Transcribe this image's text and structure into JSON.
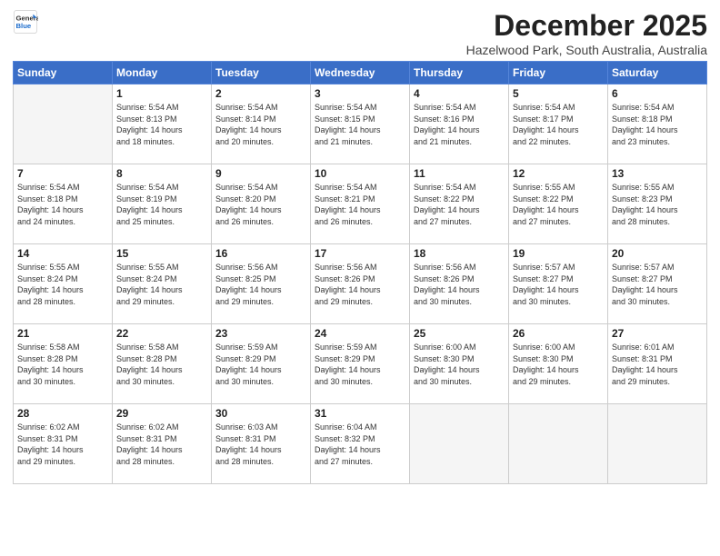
{
  "logo": {
    "general": "General",
    "blue": "Blue"
  },
  "header": {
    "title": "December 2025",
    "location": "Hazelwood Park, South Australia, Australia"
  },
  "weekdays": [
    "Sunday",
    "Monday",
    "Tuesday",
    "Wednesday",
    "Thursday",
    "Friday",
    "Saturday"
  ],
  "weeks": [
    [
      {
        "day": "",
        "text": ""
      },
      {
        "day": "1",
        "text": "Sunrise: 5:54 AM\nSunset: 8:13 PM\nDaylight: 14 hours\nand 18 minutes."
      },
      {
        "day": "2",
        "text": "Sunrise: 5:54 AM\nSunset: 8:14 PM\nDaylight: 14 hours\nand 20 minutes."
      },
      {
        "day": "3",
        "text": "Sunrise: 5:54 AM\nSunset: 8:15 PM\nDaylight: 14 hours\nand 21 minutes."
      },
      {
        "day": "4",
        "text": "Sunrise: 5:54 AM\nSunset: 8:16 PM\nDaylight: 14 hours\nand 21 minutes."
      },
      {
        "day": "5",
        "text": "Sunrise: 5:54 AM\nSunset: 8:17 PM\nDaylight: 14 hours\nand 22 minutes."
      },
      {
        "day": "6",
        "text": "Sunrise: 5:54 AM\nSunset: 8:18 PM\nDaylight: 14 hours\nand 23 minutes."
      }
    ],
    [
      {
        "day": "7",
        "text": "Sunrise: 5:54 AM\nSunset: 8:18 PM\nDaylight: 14 hours\nand 24 minutes."
      },
      {
        "day": "8",
        "text": "Sunrise: 5:54 AM\nSunset: 8:19 PM\nDaylight: 14 hours\nand 25 minutes."
      },
      {
        "day": "9",
        "text": "Sunrise: 5:54 AM\nSunset: 8:20 PM\nDaylight: 14 hours\nand 26 minutes."
      },
      {
        "day": "10",
        "text": "Sunrise: 5:54 AM\nSunset: 8:21 PM\nDaylight: 14 hours\nand 26 minutes."
      },
      {
        "day": "11",
        "text": "Sunrise: 5:54 AM\nSunset: 8:22 PM\nDaylight: 14 hours\nand 27 minutes."
      },
      {
        "day": "12",
        "text": "Sunrise: 5:55 AM\nSunset: 8:22 PM\nDaylight: 14 hours\nand 27 minutes."
      },
      {
        "day": "13",
        "text": "Sunrise: 5:55 AM\nSunset: 8:23 PM\nDaylight: 14 hours\nand 28 minutes."
      }
    ],
    [
      {
        "day": "14",
        "text": "Sunrise: 5:55 AM\nSunset: 8:24 PM\nDaylight: 14 hours\nand 28 minutes."
      },
      {
        "day": "15",
        "text": "Sunrise: 5:55 AM\nSunset: 8:24 PM\nDaylight: 14 hours\nand 29 minutes."
      },
      {
        "day": "16",
        "text": "Sunrise: 5:56 AM\nSunset: 8:25 PM\nDaylight: 14 hours\nand 29 minutes."
      },
      {
        "day": "17",
        "text": "Sunrise: 5:56 AM\nSunset: 8:26 PM\nDaylight: 14 hours\nand 29 minutes."
      },
      {
        "day": "18",
        "text": "Sunrise: 5:56 AM\nSunset: 8:26 PM\nDaylight: 14 hours\nand 30 minutes."
      },
      {
        "day": "19",
        "text": "Sunrise: 5:57 AM\nSunset: 8:27 PM\nDaylight: 14 hours\nand 30 minutes."
      },
      {
        "day": "20",
        "text": "Sunrise: 5:57 AM\nSunset: 8:27 PM\nDaylight: 14 hours\nand 30 minutes."
      }
    ],
    [
      {
        "day": "21",
        "text": "Sunrise: 5:58 AM\nSunset: 8:28 PM\nDaylight: 14 hours\nand 30 minutes."
      },
      {
        "day": "22",
        "text": "Sunrise: 5:58 AM\nSunset: 8:28 PM\nDaylight: 14 hours\nand 30 minutes."
      },
      {
        "day": "23",
        "text": "Sunrise: 5:59 AM\nSunset: 8:29 PM\nDaylight: 14 hours\nand 30 minutes."
      },
      {
        "day": "24",
        "text": "Sunrise: 5:59 AM\nSunset: 8:29 PM\nDaylight: 14 hours\nand 30 minutes."
      },
      {
        "day": "25",
        "text": "Sunrise: 6:00 AM\nSunset: 8:30 PM\nDaylight: 14 hours\nand 30 minutes."
      },
      {
        "day": "26",
        "text": "Sunrise: 6:00 AM\nSunset: 8:30 PM\nDaylight: 14 hours\nand 29 minutes."
      },
      {
        "day": "27",
        "text": "Sunrise: 6:01 AM\nSunset: 8:31 PM\nDaylight: 14 hours\nand 29 minutes."
      }
    ],
    [
      {
        "day": "28",
        "text": "Sunrise: 6:02 AM\nSunset: 8:31 PM\nDaylight: 14 hours\nand 29 minutes."
      },
      {
        "day": "29",
        "text": "Sunrise: 6:02 AM\nSunset: 8:31 PM\nDaylight: 14 hours\nand 28 minutes."
      },
      {
        "day": "30",
        "text": "Sunrise: 6:03 AM\nSunset: 8:31 PM\nDaylight: 14 hours\nand 28 minutes."
      },
      {
        "day": "31",
        "text": "Sunrise: 6:04 AM\nSunset: 8:32 PM\nDaylight: 14 hours\nand 27 minutes."
      },
      {
        "day": "",
        "text": ""
      },
      {
        "day": "",
        "text": ""
      },
      {
        "day": "",
        "text": ""
      }
    ]
  ]
}
